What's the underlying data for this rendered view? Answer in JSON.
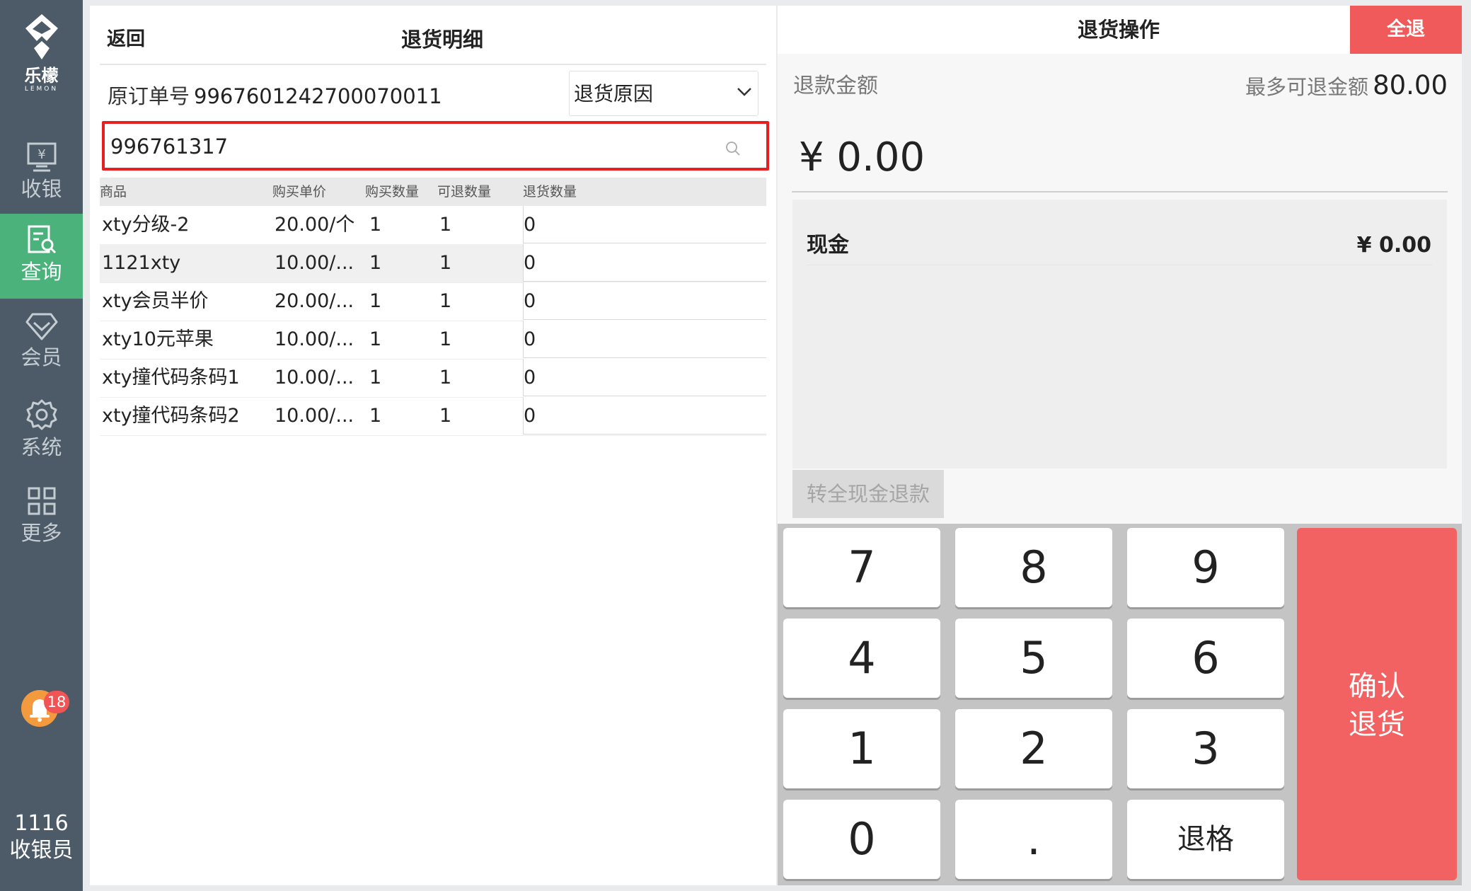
{
  "sidebar": {
    "brand": "乐檬",
    "brand_sub": "LEMON",
    "items": [
      {
        "label": "收银",
        "icon": "cash-register-icon"
      },
      {
        "label": "查询",
        "icon": "search-receipt-icon",
        "active": true
      },
      {
        "label": "会员",
        "icon": "diamond-icon"
      },
      {
        "label": "系统",
        "icon": "gear-icon"
      },
      {
        "label": "更多",
        "icon": "grid-icon"
      }
    ],
    "notification_count": "18",
    "user_id": "1116",
    "user_role": "收银员"
  },
  "left": {
    "back_label": "返回",
    "title": "退货明细",
    "order_label": "原订单号",
    "order_number": "9967601242700070011",
    "reason_placeholder": "退货原因",
    "search_value": "996761317",
    "columns": [
      "商品",
      "购买单价",
      "购买数量",
      "可退数量",
      "退货数量"
    ],
    "rows": [
      {
        "name": "xty分级-2",
        "price": "20.00/个",
        "bought": "1",
        "returnable": "1",
        "return_qty": "0"
      },
      {
        "name": "1121xty",
        "price": "10.00/...",
        "bought": "1",
        "returnable": "1",
        "return_qty": "0"
      },
      {
        "name": "xty会员半价",
        "price": "20.00/...",
        "bought": "1",
        "returnable": "1",
        "return_qty": "0"
      },
      {
        "name": "xty10元苹果",
        "price": "10.00/...",
        "bought": "1",
        "returnable": "1",
        "return_qty": "0"
      },
      {
        "name": "xty撞代码条码1",
        "price": "10.00/...",
        "bought": "1",
        "returnable": "1",
        "return_qty": "0"
      },
      {
        "name": "xty撞代码条码2",
        "price": "10.00/...",
        "bought": "1",
        "returnable": "1",
        "return_qty": "0"
      }
    ]
  },
  "right": {
    "title": "退货操作",
    "all_return": "全退",
    "refund_label": "退款金额",
    "max_label": "最多可退金额",
    "max_value": "80.00",
    "amount": "¥ 0.00",
    "cash_label": "现金",
    "cash_value": "¥ 0.00",
    "to_cash_label": "转全现金退款",
    "keys": [
      "7",
      "8",
      "9",
      "4",
      "5",
      "6",
      "1",
      "2",
      "3",
      "0",
      ".",
      "退格"
    ],
    "confirm_line1": "确认",
    "confirm_line2": "退货"
  },
  "colors": {
    "sidebar_bg": "#4c5b67",
    "active_green": "#4cb27c",
    "accent_red": "#f05a5a",
    "search_border": "#e52020"
  }
}
